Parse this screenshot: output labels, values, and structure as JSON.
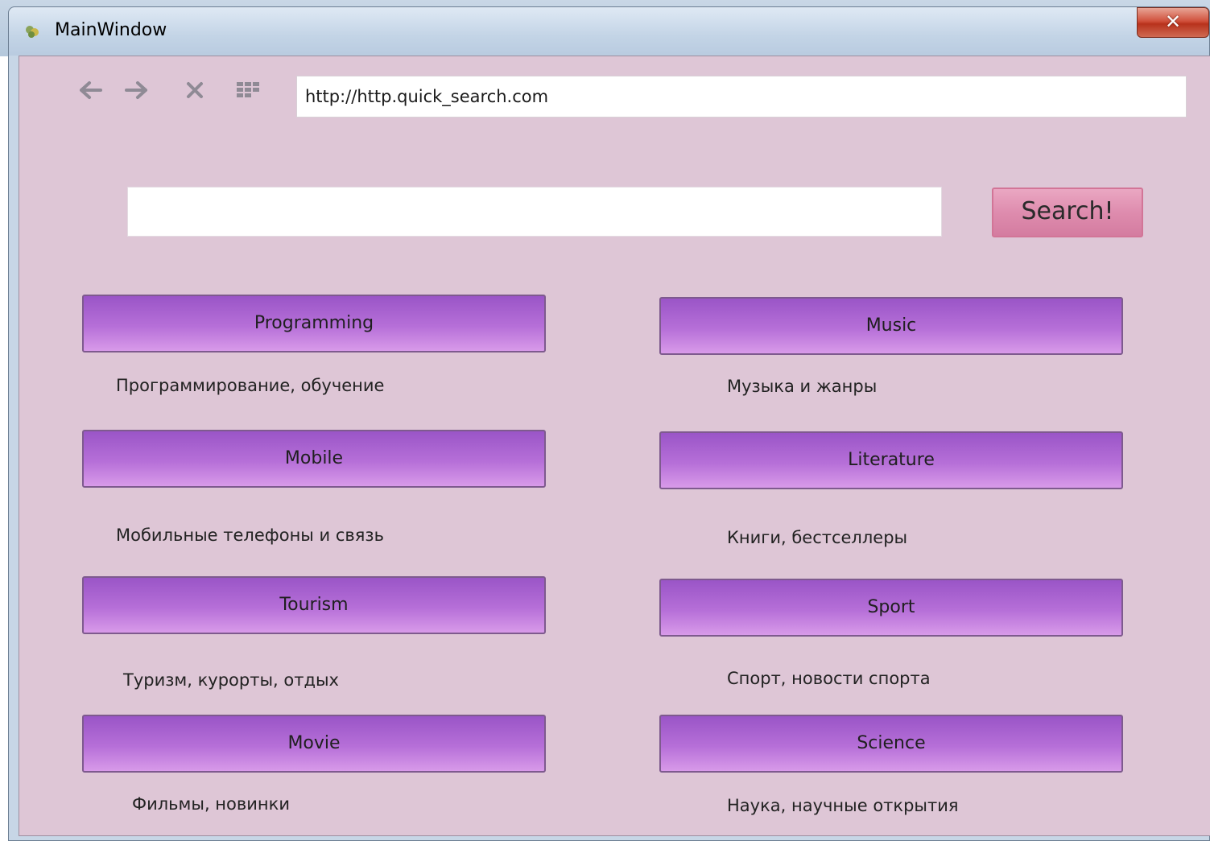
{
  "window": {
    "title": "MainWindow",
    "close_label": "✕"
  },
  "toolbar": {
    "back_icon": "arrow-left-icon",
    "forward_icon": "arrow-right-icon",
    "stop_icon": "close-icon",
    "grid_icon": "grid-icon",
    "url": "http://http.quick_search.com"
  },
  "search": {
    "value": "",
    "button_label": "Search!"
  },
  "categories": [
    {
      "label": "Programming",
      "description": "Программирование, обучение"
    },
    {
      "label": "Music",
      "description": "Музыка и жанры"
    },
    {
      "label": "Mobile",
      "description": "Мобильные телефоны и связь"
    },
    {
      "label": "Literature",
      "description": "Книги, бестселлеры"
    },
    {
      "label": "Tourism",
      "description": "Туризм, курорты, отдых"
    },
    {
      "label": "Sport",
      "description": "Спорт, новости спорта"
    },
    {
      "label": "Movie",
      "description": "Фильмы, новинки"
    },
    {
      "label": "Science",
      "description": "Наука, научные открытия"
    }
  ],
  "colors": {
    "client_background": "#dec6d6",
    "category_button": "#b66fd8",
    "search_button": "#de8cae"
  }
}
